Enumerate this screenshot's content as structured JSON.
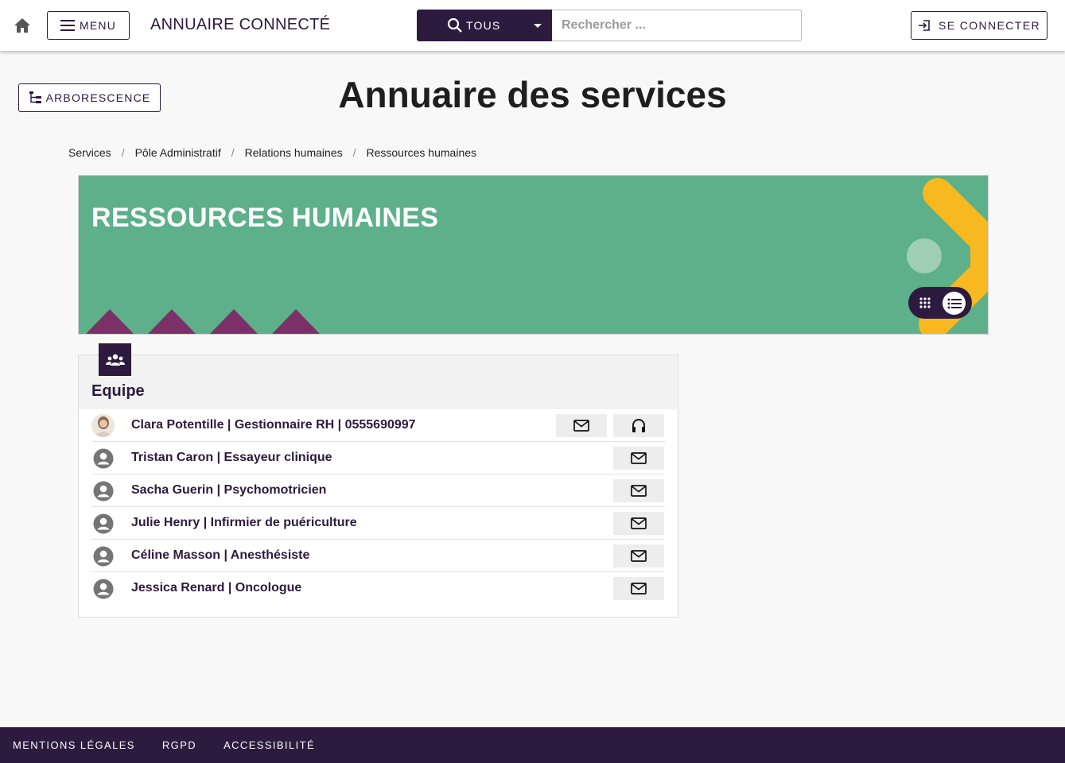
{
  "header": {
    "menu_label": "MENU",
    "app_title": "ANNUAIRE CONNECTÉ",
    "search_scope": "TOUS",
    "search_placeholder": "Rechercher ...",
    "login_label": "SE CONNECTER"
  },
  "page": {
    "tree_label": "ARBORESCENCE",
    "title": "Annuaire des services"
  },
  "breadcrumb": [
    "Services",
    "Pôle Administratif",
    "Relations humaines",
    "Ressources humaines"
  ],
  "banner": {
    "title": "RESSOURCES HUMAINES",
    "colors": {
      "background": "#5db08a",
      "accent_yellow": "#f8b820",
      "triangles": "#7b3168"
    }
  },
  "team": {
    "title": "Equipe",
    "members": [
      {
        "label": "Clara Potentille | Gestionnaire RH | 0555690997",
        "avatar": "photo",
        "actions": [
          "mail-icon",
          "headset-icon"
        ]
      },
      {
        "label": "Tristan Caron | Essayeur clinique",
        "avatar": "person-icon",
        "actions": [
          "mail-icon"
        ]
      },
      {
        "label": "Sacha Guerin | Psychomotricien",
        "avatar": "person-icon",
        "actions": [
          "mail-icon"
        ]
      },
      {
        "label": "Julie Henry | Infirmier de puériculture",
        "avatar": "person-icon",
        "actions": [
          "mail-icon"
        ]
      },
      {
        "label": "Céline Masson | Anesthésiste",
        "avatar": "person-icon",
        "actions": [
          "mail-icon"
        ]
      },
      {
        "label": "Jessica Renard | Oncologue",
        "avatar": "person-icon",
        "actions": [
          "mail-icon"
        ]
      }
    ]
  },
  "footer": {
    "links": [
      "MENTIONS LÉGALES",
      "RGPD",
      "ACCESSIBILITÉ"
    ]
  },
  "theme": {
    "primary": "#2d1a3f",
    "page_bg": "#f8f8f8"
  }
}
